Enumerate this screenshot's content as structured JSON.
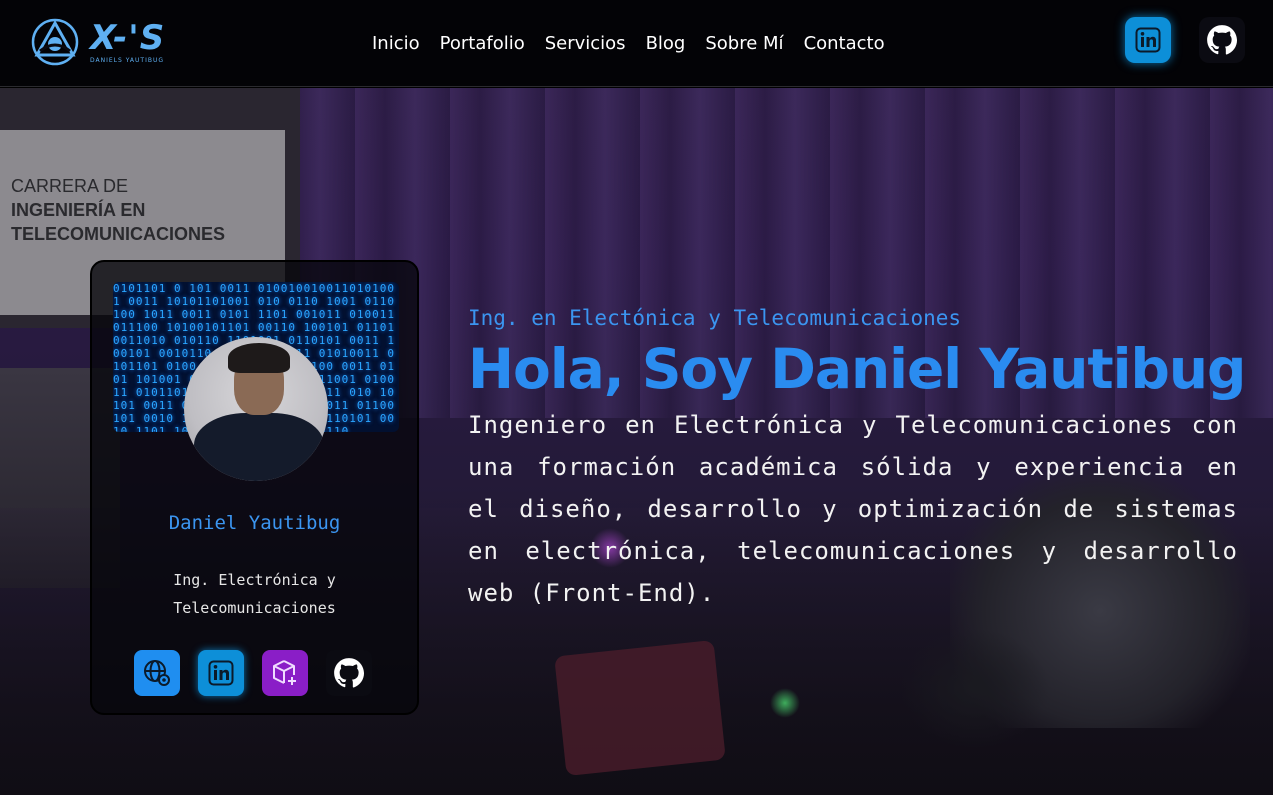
{
  "brand": {
    "logo_text": "X-'S",
    "logo_subtext": "DANIELS YAUTIBUG",
    "accent_color": "#3b95f0"
  },
  "nav": {
    "links": [
      "Inicio",
      "Portafolio",
      "Servicios",
      "Blog",
      "Sobre Mí",
      "Contacto"
    ],
    "social": [
      {
        "icon": "linkedin-icon"
      },
      {
        "icon": "github-icon"
      }
    ]
  },
  "background": {
    "paper_lines": [
      "CARRERA DE",
      "INGENIERÍA EN",
      "TELECOMUNICACIONES"
    ]
  },
  "profile_card": {
    "name": "Daniel Yautibug",
    "role_line1": "Ing. Electrónica y",
    "role_line2": "Telecomunicaciones",
    "cover_binary": "0101101 0 101 0011 0100100100110101001 0011 10101101001 010 0110 1001 0110100 1011 0011 0101 1101 001011 010011 011100 10100101101 00110 100101 01101 0011010 010110 1101001 0110101 0011 100101 0010110 1010101 0011 01010011 0101101 0100 11101 00101 10100 0011 0101 101001 0010110 0110101 011001 010011 0101101 011001 0010110 1011 010 10101 0011 010110 10110 0101 0011 01100101 0010 1011 01001 01100 10110101 0010 1101 1010 0110 01011 0010110",
    "icons": [
      "globe-network-icon",
      "linkedin-icon",
      "cube-add-icon",
      "github-icon"
    ]
  },
  "hero": {
    "eyebrow": "Ing. en Electónica y Telecomunicaciones",
    "headline": "Hola, Soy Daniel Yautibug",
    "description": "Ingeniero en Electrónica y Telecomunicaciones con una formación académica sólida y experiencia en el diseño, desarrollo y optimización de sistemas en electrónica, telecomunicaciones y desarrollo web (Front-End)."
  }
}
